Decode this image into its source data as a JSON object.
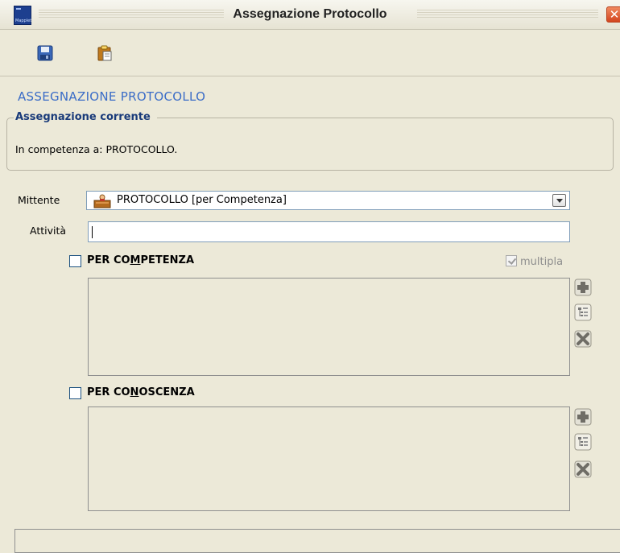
{
  "window": {
    "title": "Assegnazione Protocollo",
    "app_logo_text": "Mapplet"
  },
  "toolbar": {
    "buttons": [
      {
        "icon": "save-icon"
      },
      {
        "icon": "clipboard-icon"
      }
    ]
  },
  "section": {
    "heading": "ASSEGNAZIONE PROTOCOLLO"
  },
  "current_assignment": {
    "legend": "Assegnazione corrente",
    "text": "In competenza a: PROTOCOLLO."
  },
  "form": {
    "mittente_label": "Mittente",
    "mittente_value": "PROTOCOLLO [per Competenza]",
    "attivita_label": "Attività",
    "attivita_value": ""
  },
  "competenza": {
    "label_pre": "PER CO",
    "label_mnemonic": "M",
    "label_post": "PETENZA",
    "checked": false,
    "multipla_label": "multipla",
    "multipla_checked": true
  },
  "conoscenza": {
    "label_pre": "PER CO",
    "label_mnemonic": "N",
    "label_post": "OSCENZA",
    "checked": false
  },
  "side_buttons": [
    "add-icon",
    "tree-icon",
    "delete-icon"
  ],
  "colors": {
    "heading": "#3a6cc7",
    "legend": "#1a3b7a",
    "background": "#ece9d8"
  }
}
